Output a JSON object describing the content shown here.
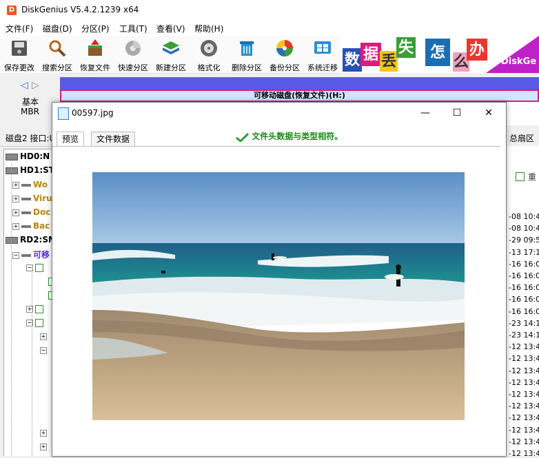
{
  "app": {
    "title": "DiskGenius V5.4.2.1239 x64",
    "icon_letter": "D"
  },
  "menu": [
    "文件(F)",
    "磁盘(D)",
    "分区(P)",
    "工具(T)",
    "查看(V)",
    "帮助(H)"
  ],
  "toolbar": [
    "保存更改",
    "搜索分区",
    "恢复文件",
    "快速分区",
    "新建分区",
    "格式化",
    "删除分区",
    "备份分区",
    "系统迁移"
  ],
  "banner": {
    "chars": [
      "数",
      "据",
      "丢",
      "失",
      "怎",
      "么",
      "办"
    ],
    "brand": "DiskGe"
  },
  "disk_nav": {
    "line1": "基本",
    "line2": "MBR"
  },
  "disk_bar": {
    "partition_label": "可移动磁盘(恢复文件)(H:)"
  },
  "disk_info": {
    "left": "磁盘2 接口:U",
    "right": "总扇区数"
  },
  "tree": [
    {
      "label": "HD0:N",
      "color": "#000"
    },
    {
      "label": "HD1:ST",
      "color": "#000"
    },
    {
      "label": "Wo",
      "color": "#b8860b"
    },
    {
      "label": "Viru",
      "color": "#b8860b"
    },
    {
      "label": "Doc",
      "color": "#b8860b"
    },
    {
      "label": "Bac",
      "color": "#b8860b"
    },
    {
      "label": "RD2:SM",
      "color": "#000"
    },
    {
      "label": "可移",
      "color": "#5a2ad4"
    }
  ],
  "right_times": [
    "-08 10:4",
    "-08 10:4",
    "-29 09:5",
    "-13 17:1",
    "-16 16:0",
    "-16 16:0",
    "-16 16:0",
    "-16 16:0",
    "-16 16:0",
    "-23 14:1",
    "-23 14:1",
    "-12 13:4",
    "-12 13:4",
    "-12 13:4",
    "-12 13:4",
    "-12 13:4",
    "-12 13:4",
    "-12 13:4",
    "-12 13:4",
    "-12 13:4",
    "-12 13:4"
  ],
  "dialog": {
    "title": "00597.jpg",
    "tabs": [
      "预览",
      "文件数据"
    ],
    "status": "文件头数据与类型相符。",
    "minimize": "—",
    "maximize": "☐",
    "close": "✕"
  },
  "colors": {
    "accent_pink": "#e0197d",
    "disk_blue": "#5a5ae8",
    "status_green": "#1a8a1a"
  }
}
